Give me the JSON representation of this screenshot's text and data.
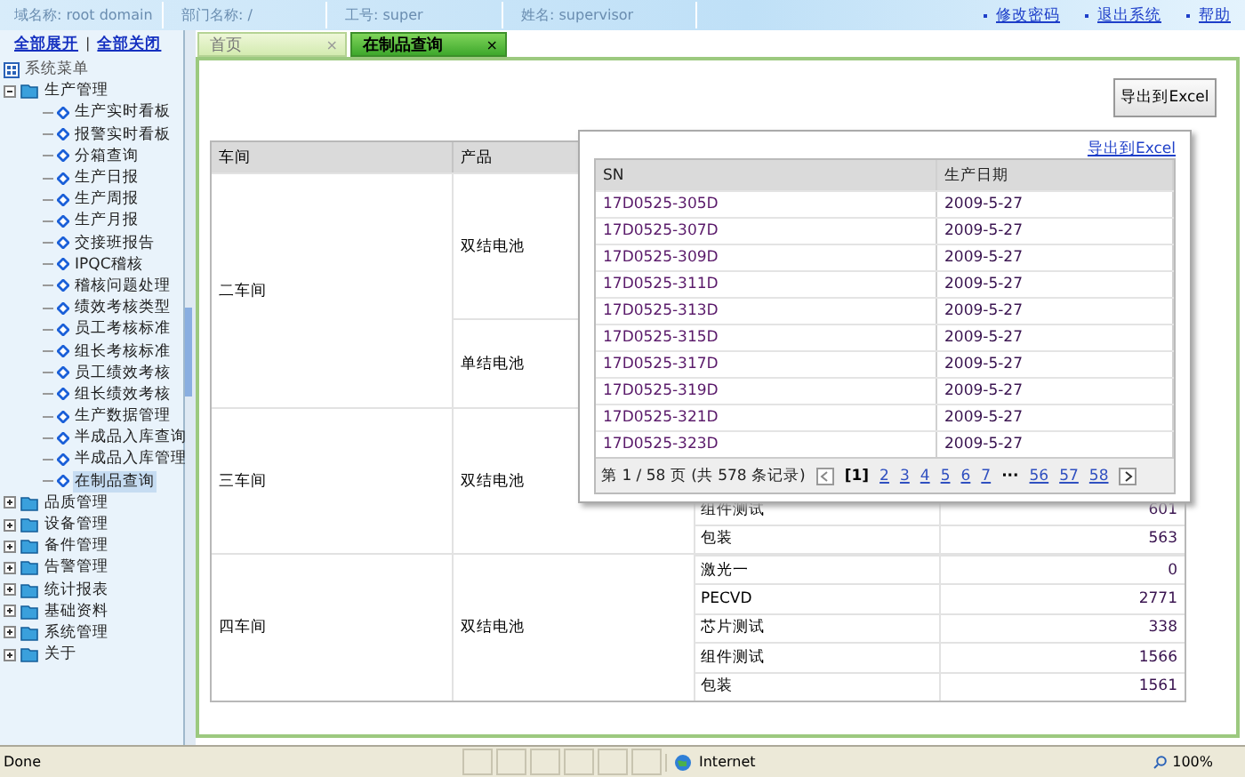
{
  "header": {
    "fields": [
      {
        "label": "域名称:",
        "value": "root domain"
      },
      {
        "label": "部门名称:",
        "value": "/"
      },
      {
        "label": "工号:",
        "value": "super"
      },
      {
        "label": "姓名:",
        "value": "supervisor"
      }
    ],
    "links": [
      "修改密码",
      "退出系统",
      "帮助"
    ]
  },
  "sidebar": {
    "links": [
      "全部展开",
      "全部关闭"
    ],
    "separator": "|",
    "menu": {
      "title": "系统菜单",
      "items": [
        {
          "label": "生产管理",
          "expanded": true,
          "children": [
            {
              "label": "生产实时看板",
              "selected": false
            },
            {
              "label": "报警实时看板",
              "selected": false
            },
            {
              "label": "分箱查询",
              "selected": false
            },
            {
              "label": "生产日报",
              "selected": false
            },
            {
              "label": "生产周报",
              "selected": false
            },
            {
              "label": "生产月报",
              "selected": false
            },
            {
              "label": "交接班报告",
              "selected": false
            },
            {
              "label": "IPQC稽核",
              "selected": false
            },
            {
              "label": "稽核问题处理",
              "selected": false
            },
            {
              "label": "绩效考核类型",
              "selected": false
            },
            {
              "label": "员工考核标准",
              "selected": false
            },
            {
              "label": "组长考核标准",
              "selected": false
            },
            {
              "label": "员工绩效考核",
              "selected": false
            },
            {
              "label": "组长绩效考核",
              "selected": false
            },
            {
              "label": "生产数据管理",
              "selected": false
            },
            {
              "label": "半成品入库查询",
              "selected": false
            },
            {
              "label": "半成品入库管理",
              "selected": false
            },
            {
              "label": "在制品查询",
              "selected": true
            }
          ]
        },
        {
          "label": "品质管理",
          "expanded": false
        },
        {
          "label": "设备管理",
          "expanded": false
        },
        {
          "label": "备件管理",
          "expanded": false
        },
        {
          "label": "告警管理",
          "expanded": false
        },
        {
          "label": "统计报表",
          "expanded": false
        },
        {
          "label": "基础资料",
          "expanded": false
        },
        {
          "label": "系统管理",
          "expanded": false
        },
        {
          "label": "关于",
          "expanded": false
        }
      ]
    }
  },
  "tabs": [
    {
      "label": "首页",
      "selected": false,
      "close": "×"
    },
    {
      "label": "在制品查询",
      "selected": true,
      "close": "×"
    }
  ],
  "export_button": "导出到Excel",
  "table": {
    "columns": [
      "车间",
      "产品"
    ],
    "workshops": [
      {
        "name": "二车间",
        "products": [
          {
            "name": "双结电池"
          },
          {
            "name": "单结电池"
          }
        ]
      },
      {
        "name": "三车间",
        "products": [
          {
            "name": "双结电池",
            "processes": [
              {
                "name": "组件测试",
                "count": "601"
              },
              {
                "name": "包装",
                "count": "563"
              }
            ]
          }
        ]
      },
      {
        "name": "四车间",
        "products": [
          {
            "name": "双结电池",
            "processes": [
              {
                "name": "激光一",
                "count": "0"
              },
              {
                "name": "PECVD",
                "count": "2771"
              },
              {
                "name": "芯片测试",
                "count": "338"
              },
              {
                "name": "组件测试",
                "count": "1566"
              },
              {
                "name": "包装",
                "count": "1561"
              }
            ]
          }
        ]
      }
    ]
  },
  "popup": {
    "export_link": "导出到Excel",
    "columns": [
      "SN",
      "生产日期"
    ],
    "rows": [
      {
        "sn": "17D0525-305D",
        "date": "2009-5-27"
      },
      {
        "sn": "17D0525-307D",
        "date": "2009-5-27"
      },
      {
        "sn": "17D0525-309D",
        "date": "2009-5-27"
      },
      {
        "sn": "17D0525-311D",
        "date": "2009-5-27"
      },
      {
        "sn": "17D0525-313D",
        "date": "2009-5-27"
      },
      {
        "sn": "17D0525-315D",
        "date": "2009-5-27"
      },
      {
        "sn": "17D0525-317D",
        "date": "2009-5-27"
      },
      {
        "sn": "17D0525-319D",
        "date": "2009-5-27"
      },
      {
        "sn": "17D0525-321D",
        "date": "2009-5-27"
      },
      {
        "sn": "17D0525-323D",
        "date": "2009-5-27"
      }
    ],
    "pager": {
      "summary": "第 1 / 58 页 (共 578 条记录)",
      "pages": [
        {
          "kind": "page",
          "label": "[1]",
          "selected": true
        },
        {
          "kind": "page",
          "label": "2",
          "selected": false
        },
        {
          "kind": "page",
          "label": "3",
          "selected": false
        },
        {
          "kind": "page",
          "label": "4",
          "selected": false
        },
        {
          "kind": "page",
          "label": "5",
          "selected": false
        },
        {
          "kind": "page",
          "label": "6",
          "selected": false
        },
        {
          "kind": "page",
          "label": "7",
          "selected": false
        },
        {
          "kind": "ellipsis",
          "label": "···"
        },
        {
          "kind": "page",
          "label": "56",
          "selected": false
        },
        {
          "kind": "page",
          "label": "57",
          "selected": false
        },
        {
          "kind": "page",
          "label": "58",
          "selected": false
        }
      ]
    }
  },
  "status_bar": {
    "text": "Done",
    "zone": "Internet",
    "zoom": "100%"
  }
}
